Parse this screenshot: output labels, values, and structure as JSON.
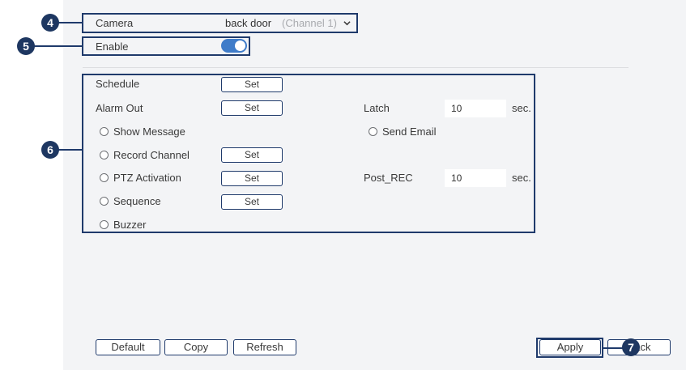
{
  "camera": {
    "label": "Camera",
    "value": "back door",
    "channel": "(Channel 1)"
  },
  "enable": {
    "label": "Enable",
    "on": true
  },
  "rows": {
    "schedule": {
      "label": "Schedule",
      "button": "Set"
    },
    "alarm_out": {
      "label": "Alarm Out",
      "button": "Set"
    },
    "latch": {
      "label": "Latch",
      "value": "10",
      "unit": "sec."
    },
    "show_message": {
      "label": "Show Message"
    },
    "send_email": {
      "label": "Send Email"
    },
    "record_channel": {
      "label": "Record Channel",
      "button": "Set"
    },
    "ptz_activation": {
      "label": "PTZ Activation",
      "button": "Set"
    },
    "post_rec": {
      "label": "Post_REC",
      "value": "10",
      "unit": "sec."
    },
    "sequence": {
      "label": "Sequence",
      "button": "Set"
    },
    "buzzer": {
      "label": "Buzzer"
    }
  },
  "footer": {
    "default": "Default",
    "copy": "Copy",
    "refresh": "Refresh",
    "apply": "Apply",
    "back": "Back"
  },
  "callouts": {
    "c4": "4",
    "c5": "5",
    "c6": "6",
    "c7": "7"
  },
  "colors": {
    "accent": "#3f7cc9",
    "callout": "#1e3761",
    "panel_bg": "#f3f4f6"
  }
}
